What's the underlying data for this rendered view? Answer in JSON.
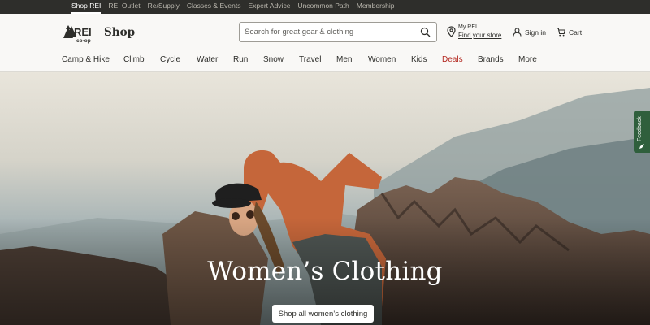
{
  "topbar": {
    "links": [
      "Shop REI",
      "REI Outlet",
      "Re/Supply",
      "Classes & Events",
      "Expert Advice",
      "Uncommon Path",
      "Membership"
    ],
    "active": "Shop REI"
  },
  "header": {
    "logo_text": "REI co-op",
    "shop_label": "Shop",
    "search_placeholder": "Search for great gear & clothing",
    "myrei_label": "My REI",
    "find_store": "Find your store",
    "signin": "Sign in",
    "cart": "Cart"
  },
  "nav": {
    "items": [
      "Camp & Hike",
      "Climb",
      "Cycle",
      "Water",
      "Run",
      "Snow",
      "Travel",
      "Men",
      "Women",
      "Kids",
      "Deals",
      "Brands",
      "More"
    ],
    "highlight": "Deals",
    "highlight_color": "#b3261e"
  },
  "hero": {
    "title": "Women’s Clothing",
    "button": "Shop all women’s clothing"
  },
  "feedback": {
    "label": "Feedback"
  },
  "colors": {
    "topbar_bg": "#2e2e2b",
    "header_bg": "#f9f8f6",
    "feedback_bg": "#2f5f3c",
    "text": "#2e2e2b"
  }
}
